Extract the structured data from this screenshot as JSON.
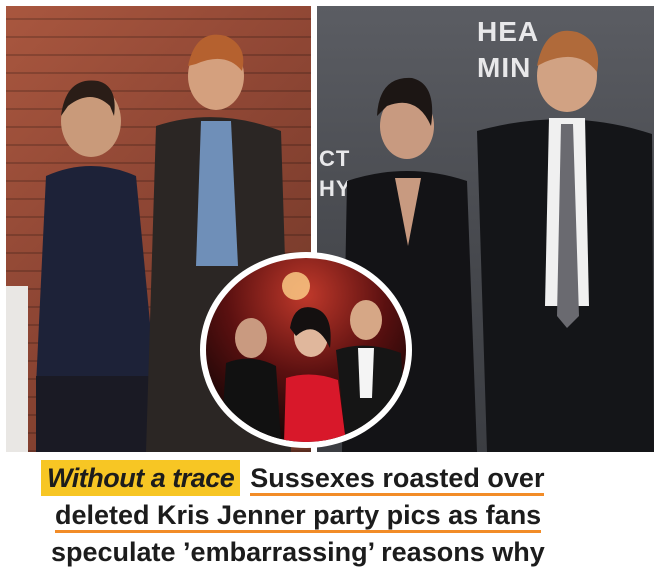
{
  "photos": {
    "right_backdrop_text": [
      "HEA",
      "MIN",
      "CT",
      "HY"
    ]
  },
  "headline": {
    "kicker": "Without a trace",
    "line1": "Sussexes roasted over",
    "line2": "deleted Kris Jenner party pics as fans",
    "line3": "speculate ’embarrassing’ reasons why"
  },
  "colors": {
    "kicker_bg": "#f7c624",
    "underline": "#f28c28"
  }
}
